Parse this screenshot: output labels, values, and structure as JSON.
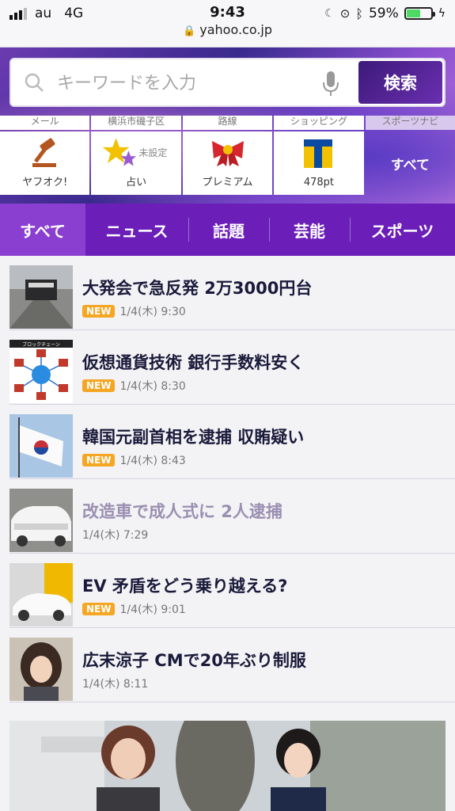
{
  "status": {
    "carrier": "au",
    "network": "4G",
    "time": "9:43",
    "battery": "59%",
    "battery_level": 0.59,
    "url": "yahoo.co.jp"
  },
  "search": {
    "placeholder": "キーワードを入力",
    "button": "検索"
  },
  "services_top": [
    "メール",
    "横浜市磯子区",
    "路線",
    "ショッピング",
    "スポーツナビ"
  ],
  "services": [
    {
      "label": "ヤフオク!",
      "icon": "auction-hammer-icon"
    },
    {
      "label": "占い",
      "sub": "未設定",
      "icon": "stars-icon"
    },
    {
      "label": "プレミアム",
      "icon": "ribbon-icon"
    },
    {
      "label": "478pt",
      "icon": "tpoint-icon"
    }
  ],
  "services_all": "すべて",
  "tabs": [
    "すべて",
    "ニュース",
    "話題",
    "芸能",
    "スポーツ"
  ],
  "news": [
    {
      "headline": "大発会で急反発 2万3000円台",
      "new": "NEW",
      "date": "1/4(木) 9:30"
    },
    {
      "headline": "仮想通貨技術 銀行手数料安く",
      "new": "NEW",
      "date": "1/4(木) 8:30"
    },
    {
      "headline": "韓国元副首相を逮捕 収賄疑い",
      "new": "NEW",
      "date": "1/4(木) 8:43"
    },
    {
      "headline": "改造車で成人式に 2人逮捕",
      "new": "",
      "date": "1/4(木) 7:29"
    },
    {
      "headline": "EV 矛盾をどう乗り越える?",
      "new": "NEW",
      "date": "1/4(木) 9:01"
    },
    {
      "headline": "広末涼子 CMで20年ぶり制服",
      "new": "",
      "date": "1/4(木) 8:11"
    }
  ],
  "thumb_labels": {
    "blockchain": "ブロックチェーン"
  }
}
